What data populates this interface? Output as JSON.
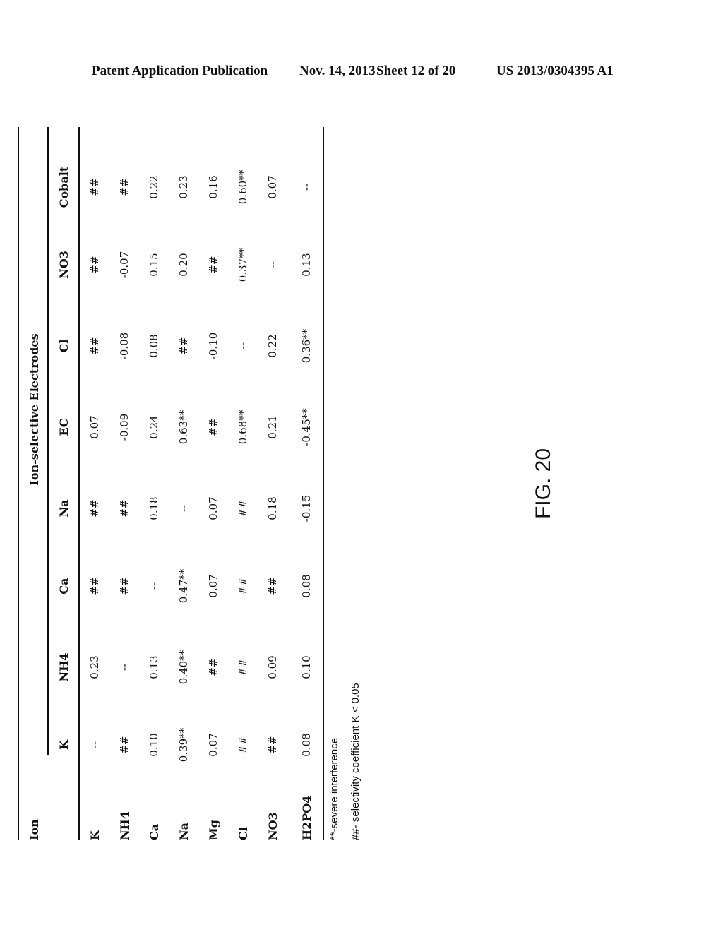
{
  "header": {
    "publication": "Patent Application Publication",
    "date": "Nov. 14, 2013",
    "sheet": "Sheet 12 of 20",
    "number": "US 2013/0304395 A1"
  },
  "table": {
    "corner_label": "Ion",
    "group_label": "Ion-selective Electrodes",
    "columns": [
      "K",
      "NH4",
      "Ca",
      "Na",
      "EC",
      "Cl",
      "NO3",
      "Cobalt"
    ],
    "rows": [
      {
        "label": "K",
        "values": [
          "--",
          "0.23",
          "##",
          "##",
          "0.07",
          "##",
          "##",
          "##"
        ]
      },
      {
        "label": "NH4",
        "values": [
          "##",
          "--",
          "##",
          "##",
          "-0.09",
          "-0.08",
          "-0.07",
          "##"
        ]
      },
      {
        "label": "Ca",
        "values": [
          "0.10",
          "0.13",
          "--",
          "0.18",
          "0.24",
          "0.08",
          "0.15",
          "0.22"
        ]
      },
      {
        "label": "Na",
        "values": [
          "0.39**",
          "0.40**",
          "0.47**",
          "--",
          "0.63**",
          "##",
          "0.20",
          "0.23"
        ]
      },
      {
        "label": "Mg",
        "values": [
          "0.07",
          "##",
          "0.07",
          "0.07",
          "##",
          "-0.10",
          "##",
          "0.16"
        ]
      },
      {
        "label": "Cl",
        "values": [
          "##",
          "##",
          "##",
          "##",
          "0.68**",
          "--",
          "0.37**",
          "0.60**"
        ]
      },
      {
        "label": "NO3",
        "values": [
          "##",
          "0.09",
          "##",
          "0.18",
          "0.21",
          "0.22",
          "--",
          "0.07"
        ]
      },
      {
        "label": "H2PO4",
        "values": [
          "0.08",
          "0.10",
          "0.08",
          "-0.15",
          "-0.45**",
          "0.36**",
          "0.13",
          "--"
        ]
      }
    ],
    "notes": [
      "**-severe interference",
      "##- selectivity coefficient K < 0.05"
    ]
  },
  "figure_label": "FIG. 20"
}
